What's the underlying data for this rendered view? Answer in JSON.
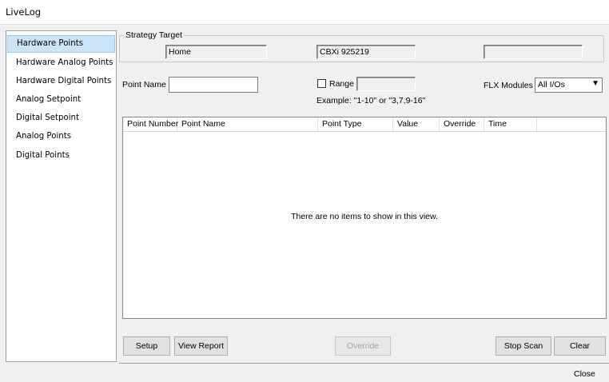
{
  "window": {
    "title": "LiveLog"
  },
  "sidebar": {
    "items": [
      {
        "label": "Hardware Points",
        "selected": true
      },
      {
        "label": "Hardware Analog Points",
        "selected": false
      },
      {
        "label": "Hardware Digital Points",
        "selected": false
      },
      {
        "label": "Analog Setpoint",
        "selected": false
      },
      {
        "label": "Digital Setpoint",
        "selected": false
      },
      {
        "label": "Analog Points",
        "selected": false
      },
      {
        "label": "Digital Points",
        "selected": false
      }
    ]
  },
  "strategy_target": {
    "legend": "Strategy Target",
    "field1": "Home",
    "field2": "CBXi 925219",
    "field3": ""
  },
  "filters": {
    "point_name_label": "Point Name",
    "point_name_value": "",
    "range_label": "Range",
    "range_value": "",
    "range_checked": false,
    "example_text": "Example: \"1-10\" or \"3,7,9-16\"",
    "flx_modules_label": "FLX Modules",
    "flx_modules_selected": "All I/Os"
  },
  "list": {
    "columns": [
      "Point Number",
      "Point Name",
      "Point Type",
      "Value",
      "Override",
      "Time",
      ""
    ],
    "empty_text": "There are no items to show in this view."
  },
  "buttons": {
    "setup": "Setup",
    "view_report": "View Report",
    "override": "Override",
    "stop_scan": "Stop Scan",
    "clear": "Clear"
  },
  "footer": {
    "close": "Close"
  },
  "colors": {
    "selected_bg": "#cce4f7",
    "selected_border": "#99c9ef"
  },
  "icons": {
    "dropdown": "chevron-down-icon"
  }
}
